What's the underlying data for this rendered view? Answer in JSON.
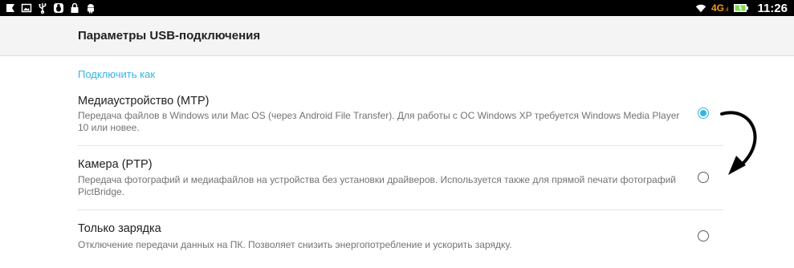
{
  "status_bar": {
    "network": "4G",
    "time": "11:26",
    "left_icons": [
      "app-icon",
      "image-icon",
      "usb-icon",
      "debug-icon",
      "lock-icon",
      "android-icon"
    ],
    "right_icons": [
      "wifi-icon",
      "signal-icon",
      "battery-icon"
    ]
  },
  "app_bar": {
    "title": "Параметры USB-подключения"
  },
  "section": {
    "title": "Подключить как"
  },
  "options": [
    {
      "title": "Медиаустройство (MTP)",
      "description": "Передача файлов в Windows или Mac OS (через Android File Transfer). Для работы с ОС Windows XP требуется Windows Media Player 10 или новее.",
      "selected": true
    },
    {
      "title": "Камера (PTP)",
      "description": "Передача фотографий и медиафайлов на устройства без установки драйверов. Используется также для прямой печати фотографий PictBridge.",
      "selected": false
    },
    {
      "title": "Только зарядка",
      "description": "Отключение передачи данных на ПК. Позволяет снизить энергопотребление и ускорить зарядку.",
      "selected": false
    }
  ],
  "colors": {
    "accent": "#33b5e5",
    "network": "#f39c12",
    "battery": "#7ed957"
  }
}
